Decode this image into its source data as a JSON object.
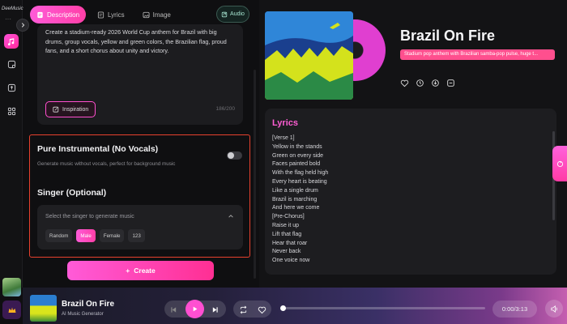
{
  "app": {
    "logo_text": "DeeMusic"
  },
  "rail": {
    "icons": [
      "music-note-icon",
      "sticker-icon",
      "upload-icon",
      "grid-icon"
    ],
    "crown_icon": "crown-icon"
  },
  "tabs": [
    {
      "label": "Description",
      "icon": "document-icon",
      "active": true
    },
    {
      "label": "Lyrics",
      "icon": "lyrics-icon",
      "active": false
    },
    {
      "label": "Image",
      "icon": "image-icon",
      "active": false
    }
  ],
  "audio_button": {
    "label": "Audio"
  },
  "description": {
    "text": "Create a stadium-ready 2026 World Cup anthem for Brazil with big drums, group vocals, yellow and green colors, the Brazilian flag, proud fans, and a short chorus about unity and victory.",
    "inspiration_label": "Inspiration",
    "counter": "186/200"
  },
  "instrumental": {
    "title": "Pure Instrumental (No Vocals)",
    "subtitle": "Generate music without vocals, perfect for background music",
    "enabled": false
  },
  "singer": {
    "title": "Singer (Optional)",
    "hint": "Select the singer to generate music",
    "options": [
      "Random",
      "Male",
      "Female",
      "123"
    ],
    "selected": "Male"
  },
  "create_button": {
    "label": "Create"
  },
  "song": {
    "title": "Brazil On Fire",
    "tag": "Stadium pop anthem with Brazilian samba-pop pulse, huge t..."
  },
  "lyrics": {
    "title": "Lyrics",
    "lines": [
      "[Verse 1]",
      "Yellow in the stands",
      "Green on every side",
      "Faces painted bold",
      "With the flag held high",
      "Every heart is beating",
      "Like a single drum",
      "Brazil is marching",
      "And here we come",
      "[Pre-Chorus]",
      "Raise it up",
      "Lift that flag",
      "Hear that roar",
      "Never back",
      "One voice now"
    ]
  },
  "player": {
    "title": "Brazil On Fire",
    "subtitle": "AI Music Generator",
    "time": "0:00/3:13",
    "progress": 0.0
  },
  "colors": {
    "accent": "#ff4fd1",
    "highlight_border": "#e8412e",
    "tag_bg": "#ff4f8e"
  }
}
